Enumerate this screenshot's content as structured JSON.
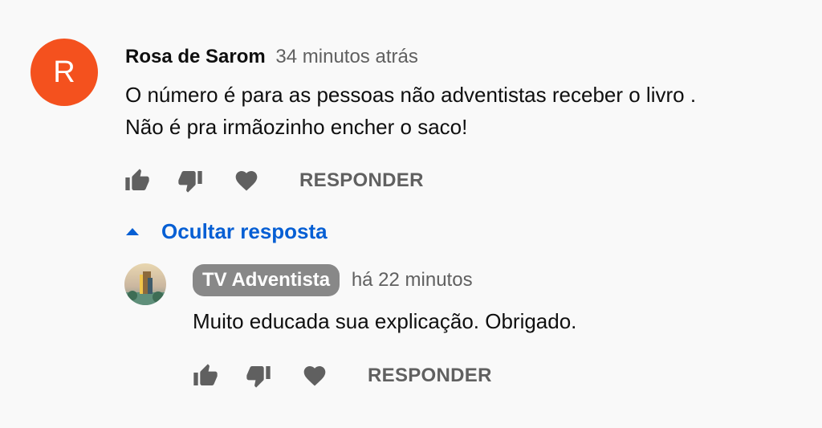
{
  "comment": {
    "avatar_letter": "R",
    "avatar_color": "#f4511e",
    "author": "Rosa de Sarom",
    "time": "34 minutos atrás",
    "text_line1": "O número é para as pessoas não adventistas receber o livro .",
    "text_line2": "Não é pra irmãozinho encher o saco!",
    "actions": {
      "like_icon": "thumbs-up-icon",
      "dislike_icon": "thumbs-down-icon",
      "heart_icon": "heart-icon",
      "reply_label": "RESPONDER"
    }
  },
  "replies_toggle": {
    "icon": "caret-up-icon",
    "label": "Ocultar resposta",
    "color": "#065fd4"
  },
  "reply": {
    "author": "TV Adventista",
    "badge_color": "#888888",
    "time": "há 22 minutos",
    "text": "Muito educada sua explicação. Obrigado.",
    "actions": {
      "like_icon": "thumbs-up-icon",
      "dislike_icon": "thumbs-down-icon",
      "heart_icon": "heart-icon",
      "reply_label": "RESPONDER"
    }
  }
}
